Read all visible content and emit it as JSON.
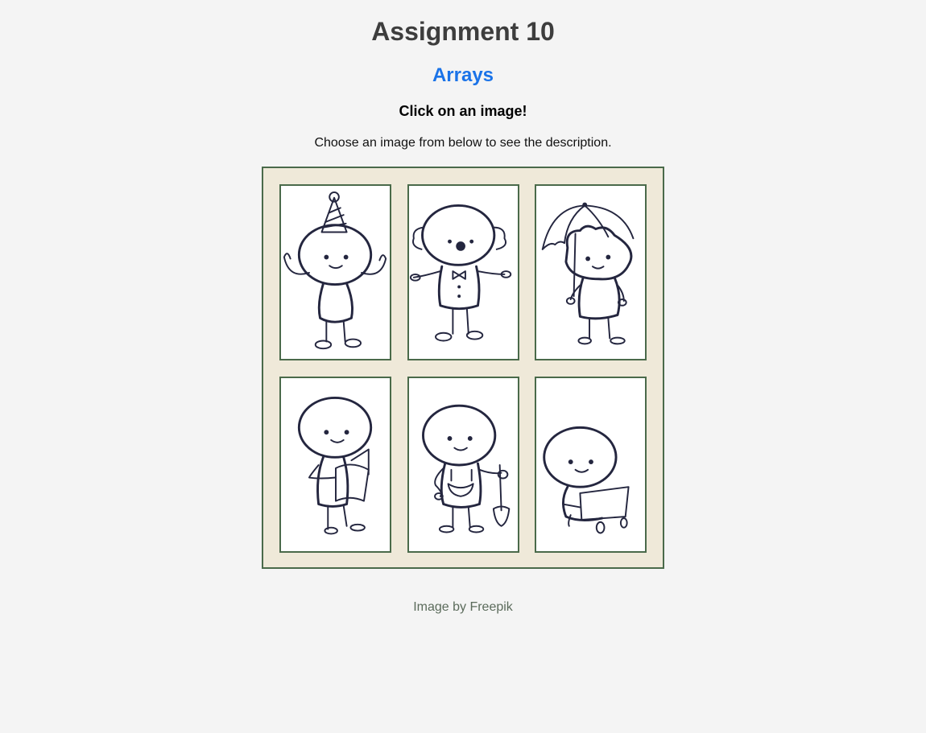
{
  "header": {
    "title": "Assignment 10",
    "subtitle": "Arrays",
    "prompt": "Click on an image!",
    "description": "Choose an image from below to see the description."
  },
  "gallery": {
    "images": [
      {
        "icon": "party-hat-character-icon"
      },
      {
        "icon": "clown-character-icon"
      },
      {
        "icon": "umbrella-character-icon"
      },
      {
        "icon": "reading-character-icon"
      },
      {
        "icon": "gardener-character-icon"
      },
      {
        "icon": "laptop-character-icon"
      }
    ]
  },
  "footer": {
    "credit_prefix": "Image by",
    "credit_link": "Freepik"
  },
  "colors": {
    "background": "#f4f4f4",
    "title": "#3d3d3d",
    "subtitle": "#1a73e8",
    "gallery_bg": "#efe9d9",
    "frame_border": "#4a6a4a",
    "line_art": "#24263f"
  }
}
